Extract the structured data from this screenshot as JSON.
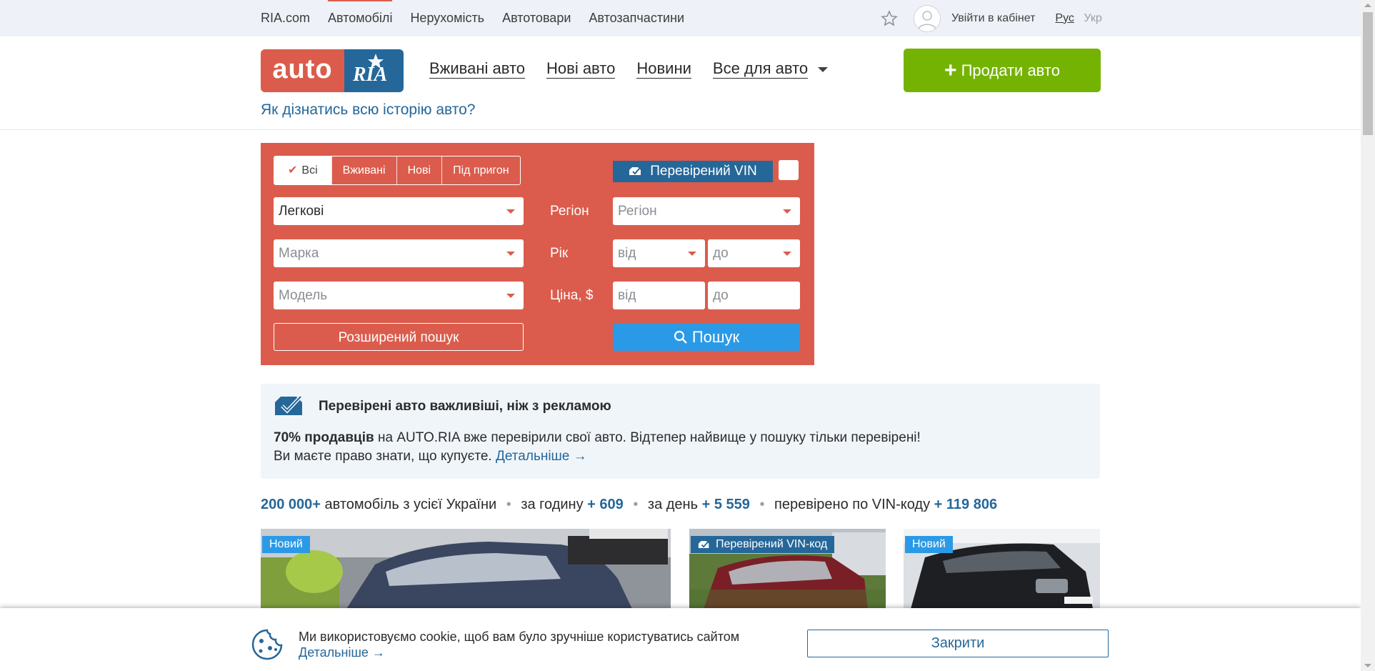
{
  "topbar": {
    "nav": [
      "RIA.com",
      "Автомобілі",
      "Нерухомість",
      "Автотовари",
      "Автозапчастини"
    ],
    "login": "Увійти в кабінет",
    "lang_rus": "Рус",
    "lang_ukr": "Укр"
  },
  "header": {
    "logo_left": "auto",
    "logo_right": "RIA",
    "nav": [
      "Вживані авто",
      "Нові авто",
      "Новини",
      "Все для авто"
    ],
    "sell_button": "Продати авто",
    "history_link": "Як дізнатись всю історію авто?"
  },
  "search": {
    "tabs": [
      "Всі",
      "Вживані",
      "Нові",
      "Під пригон"
    ],
    "vin_badge": "Перевірений VIN",
    "type_value": "Легкові",
    "brand_placeholder": "Марка",
    "model_placeholder": "Модель",
    "region_label": "Регіон",
    "region_placeholder": "Регіон",
    "year_label": "Рік",
    "year_from": "від",
    "year_to": "до",
    "price_label": "Ціна, $",
    "price_from": "від",
    "price_to": "до",
    "advanced_button": "Розширений пошук",
    "search_button": "Пошук"
  },
  "banner": {
    "title": "Перевірені авто важливіші, ніж з рекламою",
    "bold": "70% продавців",
    "text1": " на AUTO.RIA вже перевірили свої авто. Відтепер найвище у пошуку тільки перевірені!",
    "text2": "Ви маєте право знати, що купуєте. ",
    "more": "Детальніше →"
  },
  "stats": {
    "total": "200 000+",
    "total_label": "автомобіль з усієї України",
    "hour_label": "за годину",
    "hour_value": "+ 609",
    "day_label": "за день",
    "day_value": "+ 5 559",
    "vin_label": "перевірено по VIN-коду",
    "vin_value": "+ 119 806"
  },
  "cards": [
    {
      "badge": "Новий"
    },
    {
      "badge": "Перевірений VIN-код"
    },
    {
      "badge": "Новий"
    }
  ],
  "cookie": {
    "text": "Ми використовуємо cookie, щоб вам було зручніше користуватись сайтом",
    "more": "Детальніше →",
    "close": "Закрити"
  },
  "colors": {
    "brand_red": "#db5c4c",
    "brand_blue": "#256799",
    "sell_green": "#74b301",
    "search_blue": "#2b9ae6"
  }
}
